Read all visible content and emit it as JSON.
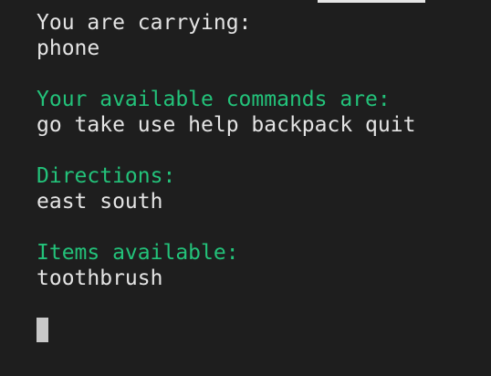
{
  "terminal": {
    "lines": {
      "carrying_label": "You are carrying:",
      "carrying_items": "phone",
      "commands_label": "Your available commands are:",
      "commands_list": "go take use help backpack quit",
      "directions_label": "Directions:",
      "directions_list": "east south",
      "items_label": "Items available:",
      "items_list": "toothbrush"
    }
  },
  "colors": {
    "background": "#1e1e1e",
    "text": "#e4e4e4",
    "heading": "#23c27a",
    "cursor": "#c8c8c8"
  }
}
